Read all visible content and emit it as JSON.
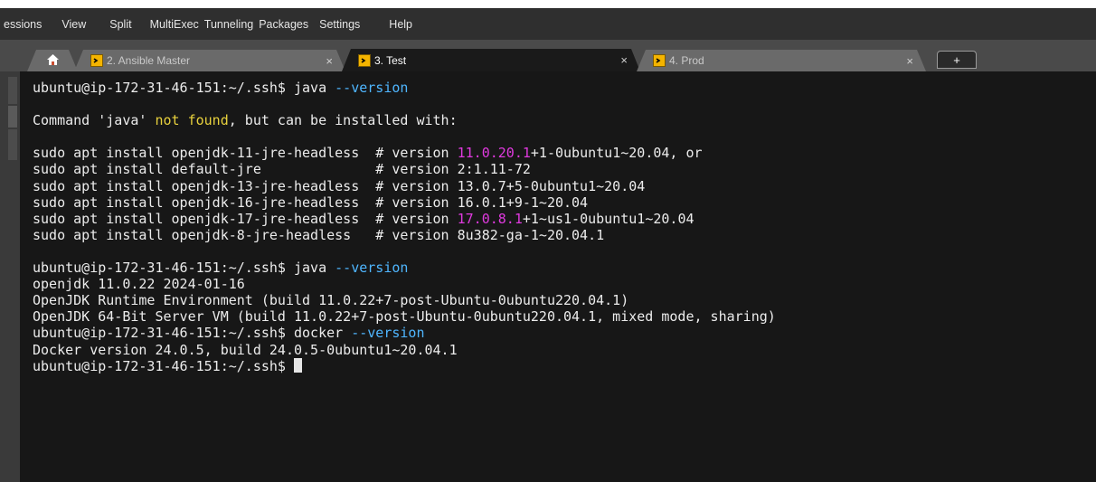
{
  "menu": [
    "essions",
    "View",
    "Split",
    "MultiExec",
    "Tunneling",
    "Packages",
    "Settings",
    "Help"
  ],
  "tabs": [
    {
      "label": "2. Ansible Master",
      "close": "×"
    },
    {
      "label": "3. Test",
      "close": "×"
    },
    {
      "label": "4. Prod",
      "close": "×"
    }
  ],
  "add_tab": "+",
  "active_tab": "3. Test",
  "colors": {
    "terminal_bg": "#171717",
    "text": "#ececec",
    "command_arg": "#4fb6ff",
    "warning": "#e8d13d",
    "highlight": "#e03adf"
  },
  "terminal": {
    "lines": [
      [
        {
          "t": "ubuntu@ip-172-31-46-151:~/.ssh$ java "
        },
        {
          "t": "--version",
          "c": "kw"
        }
      ],
      [],
      [
        {
          "t": "Command 'java' "
        },
        {
          "t": "not found",
          "c": "warn"
        },
        {
          "t": ", but can be installed with:"
        }
      ],
      [],
      [
        {
          "t": "sudo apt install openjdk-11-jre-headless  # version "
        },
        {
          "t": "11.0.20.1",
          "c": "mag"
        },
        {
          "t": "+1-0ubuntu1~20.04, or"
        }
      ],
      [
        {
          "t": "sudo apt install default-jre              # version 2:1.11-72"
        }
      ],
      [
        {
          "t": "sudo apt install openjdk-13-jre-headless  # version 13.0.7+5-0ubuntu1~20.04"
        }
      ],
      [
        {
          "t": "sudo apt install openjdk-16-jre-headless  # version 16.0.1+9-1~20.04"
        }
      ],
      [
        {
          "t": "sudo apt install openjdk-17-jre-headless  # version "
        },
        {
          "t": "17.0.8.1",
          "c": "mag"
        },
        {
          "t": "+1~us1-0ubuntu1~20.04"
        }
      ],
      [
        {
          "t": "sudo apt install openjdk-8-jre-headless   # version 8u382-ga-1~20.04.1"
        }
      ],
      [],
      [
        {
          "t": "ubuntu@ip-172-31-46-151:~/.ssh$ java "
        },
        {
          "t": "--version",
          "c": "kw"
        }
      ],
      [
        {
          "t": "openjdk 11.0.22 2024-01-16"
        }
      ],
      [
        {
          "t": "OpenJDK Runtime Environment (build 11.0.22+7-post-Ubuntu-0ubuntu220.04.1)"
        }
      ],
      [
        {
          "t": "OpenJDK 64-Bit Server VM (build 11.0.22+7-post-Ubuntu-0ubuntu220.04.1, mixed mode, sharing)"
        }
      ],
      [
        {
          "t": "ubuntu@ip-172-31-46-151:~/.ssh$ docker "
        },
        {
          "t": "--version",
          "c": "kw"
        }
      ],
      [
        {
          "t": "Docker version 24.0.5, build 24.0.5-0ubuntu1~20.04.1"
        }
      ],
      [
        {
          "t": "ubuntu@ip-172-31-46-151:~/.ssh$ "
        },
        {
          "cursor": true
        }
      ]
    ]
  }
}
